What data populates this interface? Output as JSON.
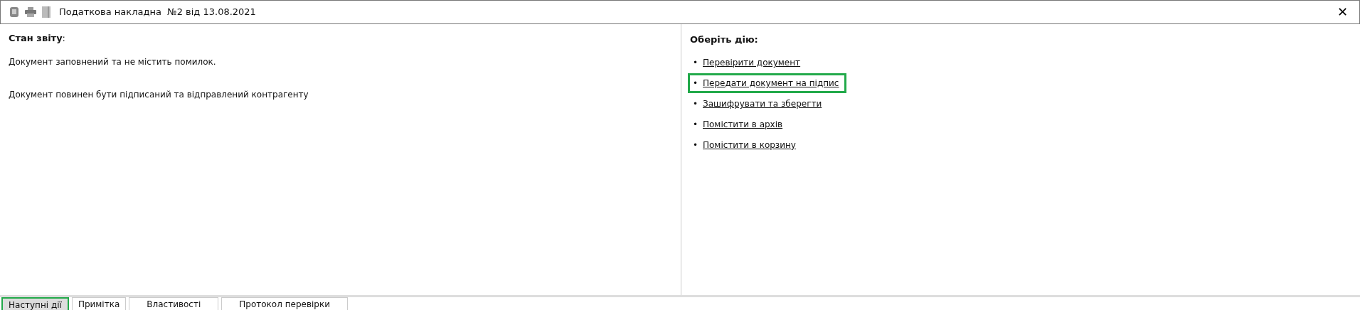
{
  "window": {
    "title": "Податкова накладна  №2 від 13.08.2021",
    "close": "✕"
  },
  "status": {
    "heading": "Стан звіту",
    "heading_suffix": ":",
    "messages": [
      "Документ заповнений та не містить помилок.",
      "Документ повинен бути підписаний та відправлений контрагенту"
    ]
  },
  "actions": {
    "heading": "Оберіть дію:",
    "bullet": "•",
    "items": [
      {
        "label": "Перевірити документ",
        "highlighted": false
      },
      {
        "label": "Передати документ на підпис",
        "highlighted": true
      },
      {
        "label": "Зашифрувати та зберегти",
        "highlighted": false
      },
      {
        "label": "Помістити в архів",
        "highlighted": false
      },
      {
        "label": "Помістити в корзину",
        "highlighted": false
      }
    ]
  },
  "tabs": [
    {
      "label": "Наступні дії",
      "selected": true
    },
    {
      "label": "Примітка",
      "selected": false
    },
    {
      "label": "Властивості",
      "selected": false
    },
    {
      "label": "Протокол перевірки",
      "selected": false
    }
  ]
}
